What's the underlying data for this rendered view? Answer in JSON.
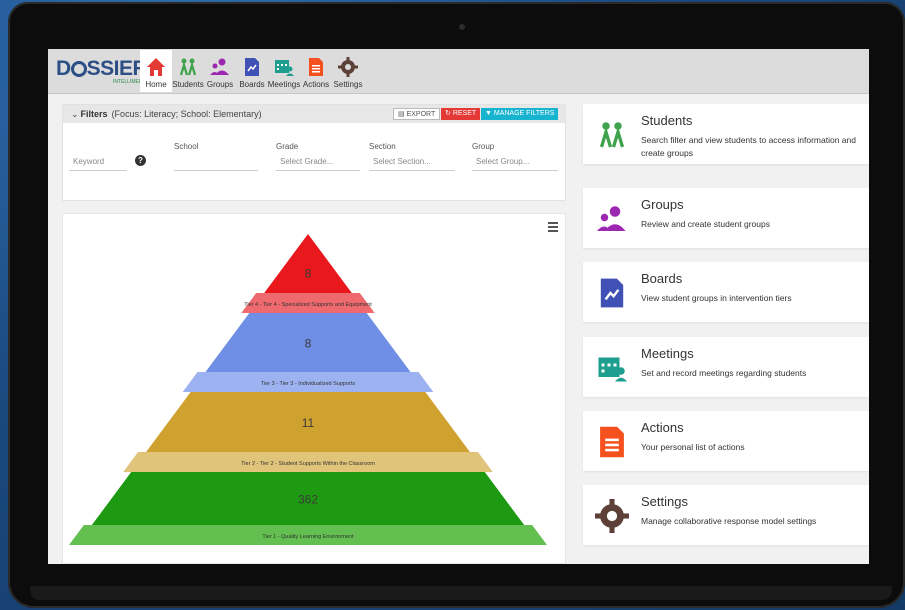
{
  "app": {
    "logo": "DOSSIER",
    "logo_sub": "INTELLIMEDIA"
  },
  "nav": [
    {
      "label": "Home",
      "icon": "home-icon",
      "color": "#e53935",
      "active": true
    },
    {
      "label": "Students",
      "icon": "students-icon",
      "color": "#3fa34d"
    },
    {
      "label": "Groups",
      "icon": "groups-icon",
      "color": "#9c27b0"
    },
    {
      "label": "Boards",
      "icon": "boards-icon",
      "color": "#3f51b5"
    },
    {
      "label": "Meetings",
      "icon": "meetings-icon",
      "color": "#1e9e8f"
    },
    {
      "label": "Actions",
      "icon": "actions-icon",
      "color": "#f4511e"
    },
    {
      "label": "Settings",
      "icon": "settings-icon",
      "color": "#5d4037"
    }
  ],
  "filters": {
    "title": "Filters",
    "focus": "(Focus: Literacy; School: Elementary)",
    "export": "EXPORT",
    "reset": "RESET",
    "manage": "MANAGE FILTERS",
    "keyword_placeholder": "Keyword",
    "school_label": "School",
    "grade_label": "Grade",
    "grade_placeholder": "Select Grade...",
    "section_label": "Section",
    "section_placeholder": "Select Section...",
    "group_label": "Group",
    "group_placeholder": "Select Group..."
  },
  "chart_data": {
    "type": "pyramid",
    "tiers": [
      {
        "label": "Tier 4 - Tier 4 - Specialized Supports and Equipment",
        "value": 8,
        "color": "#e8181c",
        "band_color": "#ef6a6e"
      },
      {
        "label": "Tier 3 - Tier 3 - Individualized Supports",
        "value": 8,
        "color": "#6f8fe6",
        "band_color": "#9db2f0"
      },
      {
        "label": "Tier 2 - Tier 2 - Student Supports Within the Classroom",
        "value": 11,
        "color": "#cfa12f",
        "band_color": "#e0c47a"
      },
      {
        "label": "Tier 1 - Quality Learning Environment",
        "value": 362,
        "color": "#1e9a12",
        "band_color": "#62bf50"
      }
    ]
  },
  "cards": [
    {
      "title": "Students",
      "desc": "Search filter and view students to access information and create groups",
      "icon": "students-icon",
      "color": "#3fa34d"
    },
    {
      "title": "Groups",
      "desc": "Review and create student groups",
      "icon": "groups-icon",
      "color": "#9c27b0"
    },
    {
      "title": "Boards",
      "desc": "View student groups in intervention tiers",
      "icon": "boards-icon",
      "color": "#3f51b5"
    },
    {
      "title": "Meetings",
      "desc": "Set and record meetings regarding students",
      "icon": "meetings-icon",
      "color": "#1e9e8f"
    },
    {
      "title": "Actions",
      "desc": "Your personal list of actions",
      "icon": "actions-icon",
      "color": "#f4511e"
    },
    {
      "title": "Settings",
      "desc": "Manage collaborative response model settings",
      "icon": "settings-icon",
      "color": "#5d4037"
    }
  ]
}
